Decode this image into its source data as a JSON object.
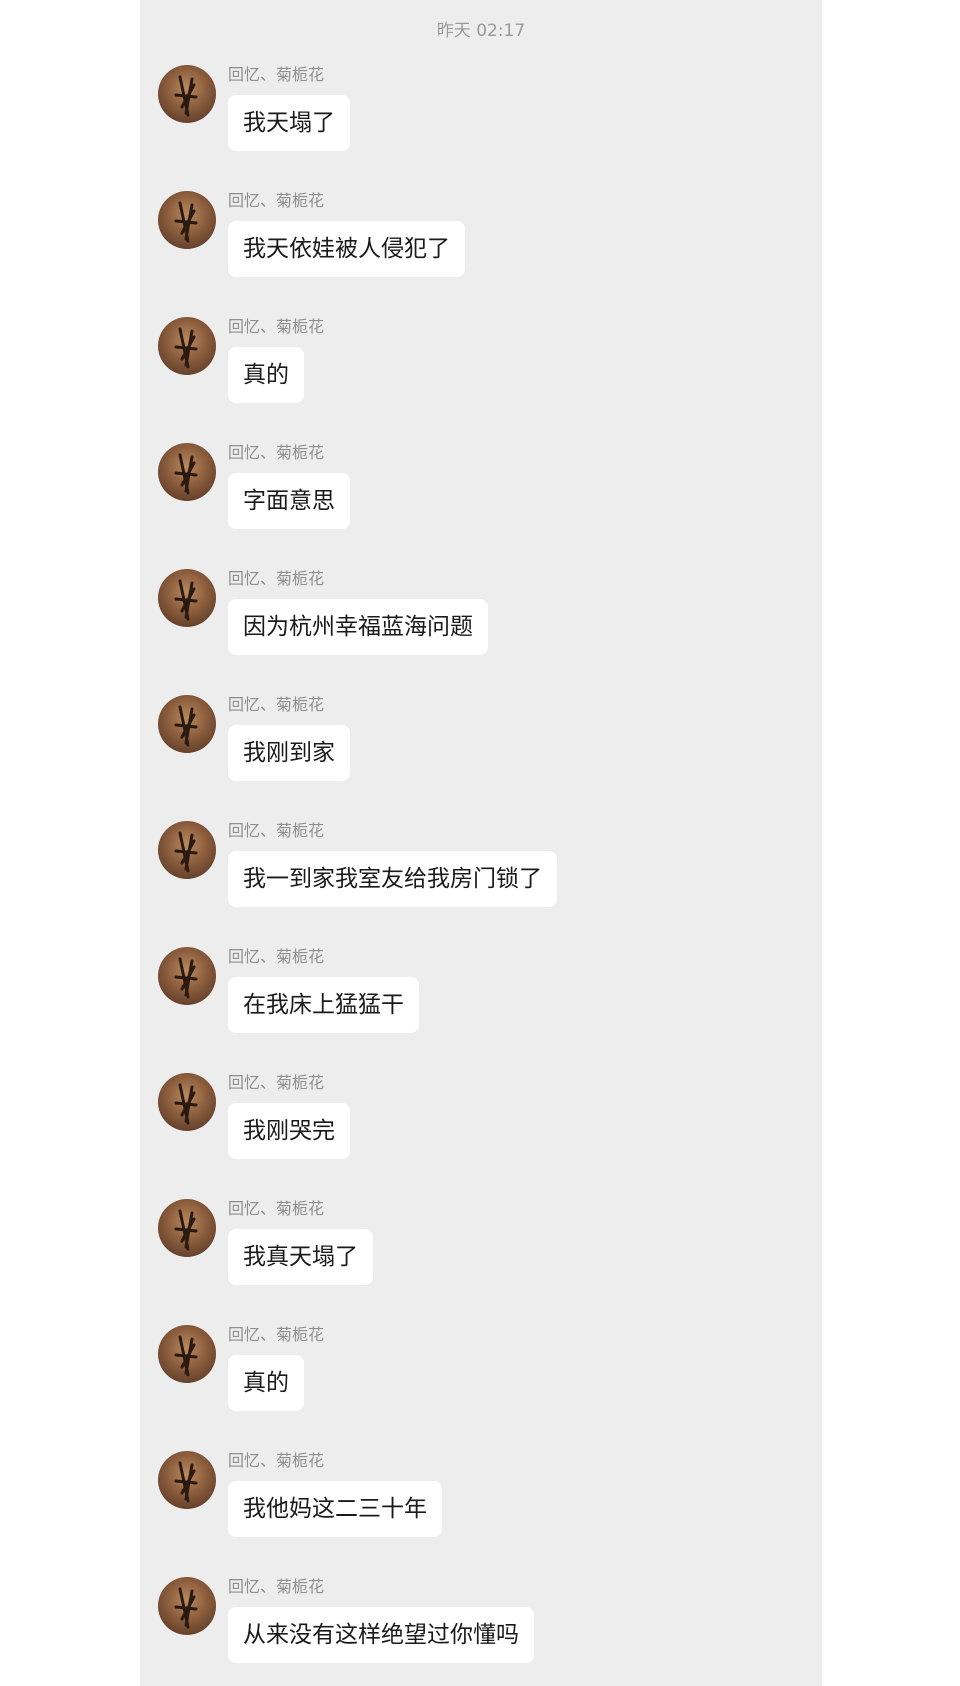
{
  "timestamp": "昨天 02:17",
  "sender_name": "回忆、菊栀花",
  "messages": [
    {
      "text": "我天塌了"
    },
    {
      "text": "我天依娃被人侵犯了"
    },
    {
      "text": "真的"
    },
    {
      "text": "字面意思"
    },
    {
      "text": "因为杭州幸福蓝海问题"
    },
    {
      "text": "我刚到家"
    },
    {
      "text": "我一到家我室友给我房门锁了"
    },
    {
      "text": "在我床上猛猛干"
    },
    {
      "text": "我刚哭完"
    },
    {
      "text": "我真天塌了"
    },
    {
      "text": "真的"
    },
    {
      "text": "我他妈这二三十年"
    },
    {
      "text": "从来没有这样绝望过你懂吗"
    }
  ]
}
